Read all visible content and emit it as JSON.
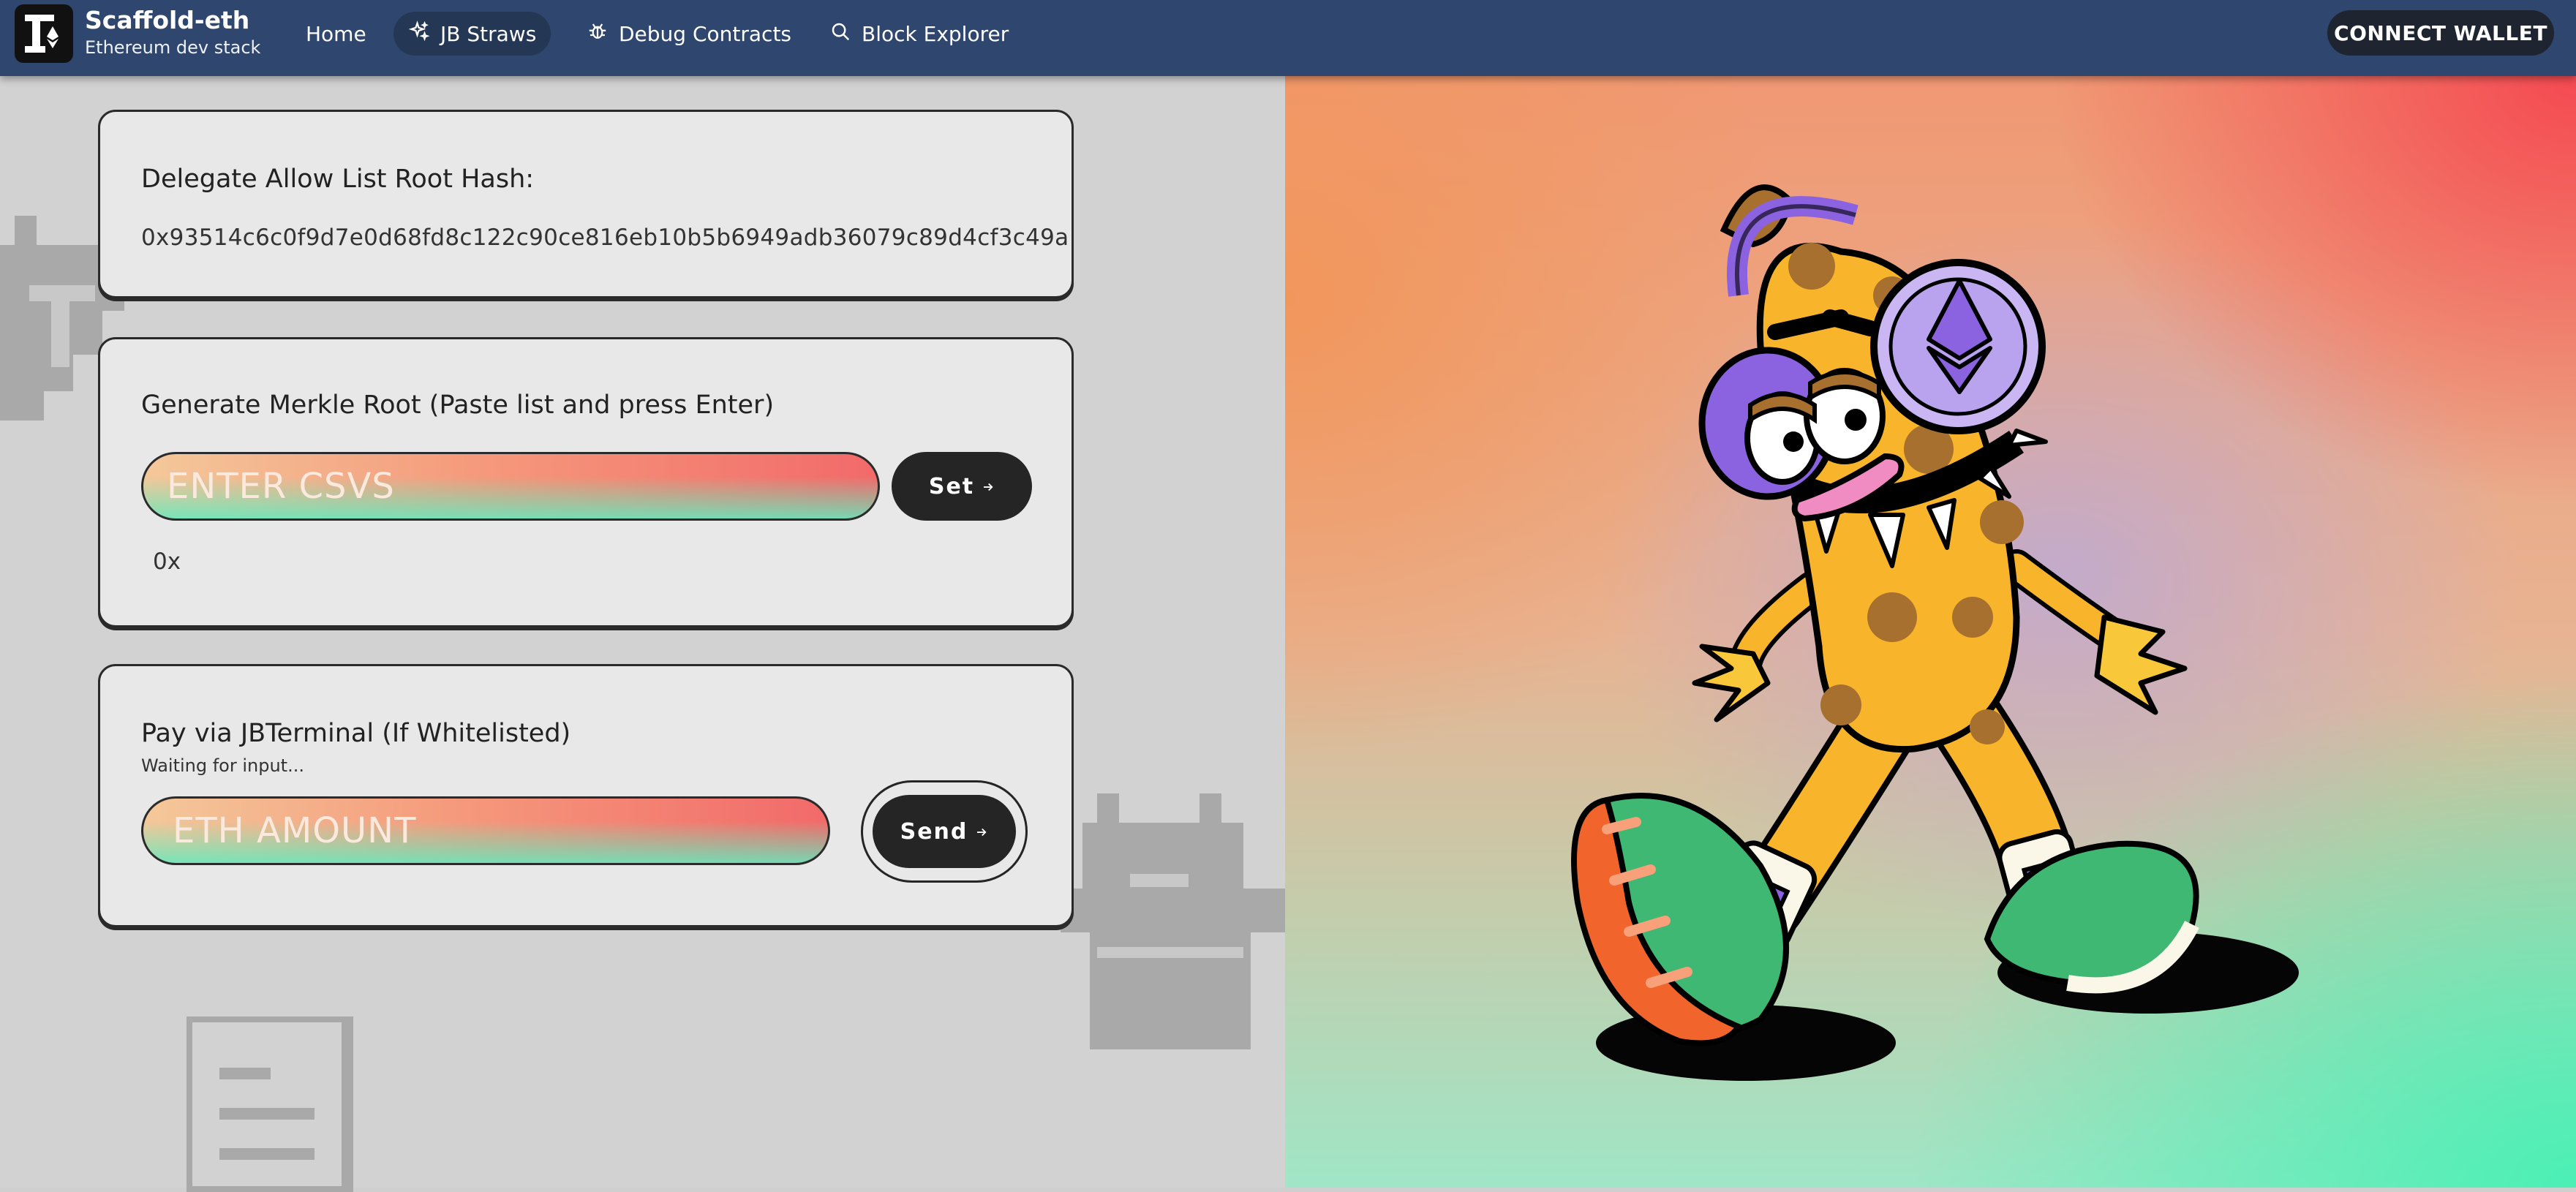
{
  "brand": {
    "title": "Scaffold-eth",
    "subtitle": "Ethereum dev stack"
  },
  "nav": {
    "home": "Home",
    "jb_straws": "JB Straws",
    "debug_contracts": "Debug Contracts",
    "block_explorer": "Block Explorer",
    "connect_wallet": "CONNECT WALLET"
  },
  "card1": {
    "title": "Delegate Allow List Root Hash:",
    "hash": "0x93514c6c0f9d7e0d68fd8c122c90ce816eb10b5b6949adb36079c89d4cf3c49a"
  },
  "card2": {
    "title": "Generate Merkle Root (Paste list and press Enter)",
    "placeholder": "ENTER CSVS",
    "button": "Set",
    "result": "0x"
  },
  "card3": {
    "title": "Pay via JBTerminal (If Whitelisted)",
    "status": "Waiting for input...",
    "placeholder": "ETH AMOUNT",
    "button": "Send"
  },
  "icons": {
    "jb_straws": "sparkles-icon",
    "debug_contracts": "bug-icon",
    "block_explorer": "search-icon",
    "button_arrow": "arrow-right-icon"
  }
}
